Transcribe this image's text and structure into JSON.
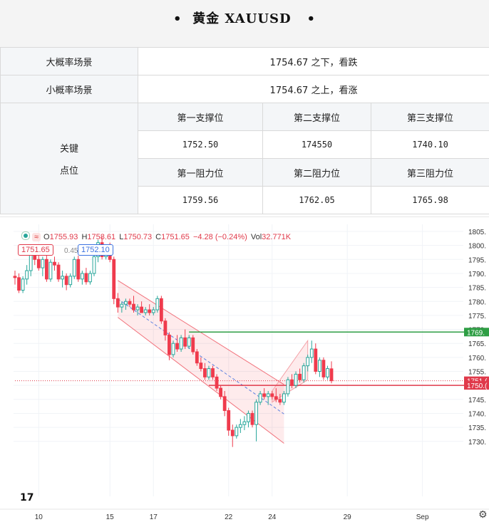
{
  "header": {
    "title": "•  黄金 XAUUSD   •"
  },
  "table": {
    "big_scenario_label": "大概率场景",
    "big_scenario_value": "1754.67 之下，看跌",
    "small_scenario_label": "小概率场景",
    "small_scenario_value": "1754.67 之上，看涨",
    "key_label_line1": "关键",
    "key_label_line2": "点位",
    "supports": [
      {
        "label": "第一支撑位",
        "value": "1752.50"
      },
      {
        "label": "第二支撑位",
        "value": "174550"
      },
      {
        "label": "第三支撑位",
        "value": "1740.10"
      }
    ],
    "resistances": [
      {
        "label": "第一阻力位",
        "value": "1759.56"
      },
      {
        "label": "第二阻力位",
        "value": "1762.05"
      },
      {
        "label": "第三阻力位",
        "value": "1765.98"
      }
    ]
  },
  "legend": {
    "wave": "≈",
    "o_label": "O",
    "o_value": "1755.93",
    "h_label": "H",
    "h_value": "1758.61",
    "l_label": "L",
    "l_value": "1750.73",
    "c_label": "C",
    "c_value": "1751.65",
    "change": "−4.28 (−0.24%)",
    "vol_label": "Vol",
    "vol_value": "32.771K"
  },
  "badges": {
    "sell": "1751.65",
    "spread": "0.45",
    "buy": "1752.10"
  },
  "chart_data": {
    "type": "candlestick",
    "y_ticks": [
      1805,
      1800,
      1795,
      1790,
      1785,
      1780,
      1775,
      1770,
      1765,
      1760,
      1755,
      1750,
      1745,
      1740,
      1735,
      1730
    ],
    "y_tick_labels": [
      "1805.",
      "1800.",
      "1795.",
      "1790.",
      "1785.",
      "1780.",
      "1775.",
      "1770.",
      "1765.",
      "1760.",
      "1755.",
      "1750.",
      "1745.",
      "1740.",
      "1735.",
      "1730."
    ],
    "x_tick_labels": [
      {
        "label": "10",
        "slot": 6
      },
      {
        "label": "15",
        "slot": 24
      },
      {
        "label": "17",
        "slot": 35
      },
      {
        "label": "22",
        "slot": 54
      },
      {
        "label": "24",
        "slot": 65
      },
      {
        "label": "29",
        "slot": 84
      },
      {
        "label": "Sep",
        "slot": 103
      }
    ],
    "price_labels": [
      {
        "text": "1769.",
        "value": 1769.05,
        "color": "#2e9e44"
      },
      {
        "text": "1751.(",
        "value": 1751.65,
        "color": "#e0394a"
      },
      {
        "text": "1750.(",
        "value": 1750.0,
        "color": "#e0394a"
      }
    ],
    "lines": [
      {
        "name": "resistance",
        "value": 1769.05,
        "from_slot": 44,
        "color": "#2e9e44"
      },
      {
        "name": "support",
        "value": 1750.0,
        "from_slot": 49,
        "color": "#e0394a"
      },
      {
        "name": "last-price",
        "value": 1751.65,
        "from_slot": 0,
        "color": "#e0394a"
      }
    ],
    "channel": {
      "upper_start": {
        "slot": 26,
        "value": 1787.5
      },
      "upper_end": {
        "slot": 68,
        "value": 1750.3
      },
      "lower_start": {
        "slot": 26,
        "value": 1774.3
      },
      "lower_end": {
        "slot": 68,
        "value": 1729.3
      },
      "mid_start": {
        "slot": 26,
        "value": 1780.9
      },
      "mid_end": {
        "slot": 68,
        "value": 1739.8
      }
    },
    "up_channel": {
      "upper_start": {
        "slot": 65,
        "value": 1748.0
      },
      "upper_end": {
        "slot": 74,
        "value": 1766.0
      },
      "lower_start": {
        "slot": 65,
        "value": 1744.0
      },
      "lower_end": {
        "slot": 74,
        "value": 1752.0
      }
    },
    "candles": [
      [
        1789.0,
        1791.0,
        1786.0,
        1788.5
      ],
      [
        1788.5,
        1790.0,
        1783.0,
        1784.0
      ],
      [
        1784.0,
        1789.0,
        1783.0,
        1788.0
      ],
      [
        1788.0,
        1793.0,
        1786.0,
        1791.0
      ],
      [
        1791.0,
        1798.0,
        1789.0,
        1797.0
      ],
      [
        1797.0,
        1799.0,
        1793.0,
        1795.0
      ],
      [
        1795.0,
        1797.0,
        1791.0,
        1792.0
      ],
      [
        1792.0,
        1796.0,
        1789.0,
        1795.0
      ],
      [
        1795.0,
        1797.0,
        1787.0,
        1788.0
      ],
      [
        1788.0,
        1795.0,
        1787.0,
        1794.0
      ],
      [
        1794.0,
        1796.0,
        1791.0,
        1793.0
      ],
      [
        1793.0,
        1794.0,
        1787.0,
        1788.0
      ],
      [
        1788.0,
        1791.0,
        1785.0,
        1789.0
      ],
      [
        1789.0,
        1790.0,
        1784.0,
        1786.0
      ],
      [
        1786.0,
        1790.0,
        1785.0,
        1789.0
      ],
      [
        1789.0,
        1796.0,
        1788.0,
        1795.0
      ],
      [
        1795.0,
        1797.0,
        1787.0,
        1788.0
      ],
      [
        1788.0,
        1791.0,
        1786.0,
        1790.0
      ],
      [
        1790.0,
        1792.0,
        1786.0,
        1787.0
      ],
      [
        1787.0,
        1791.0,
        1786.0,
        1790.0
      ],
      [
        1790.0,
        1797.0,
        1789.0,
        1796.0
      ],
      [
        1796.0,
        1802.0,
        1794.0,
        1801.0
      ],
      [
        1801.0,
        1803.0,
        1795.0,
        1796.0
      ],
      [
        1796.0,
        1799.0,
        1795.0,
        1798.0
      ],
      [
        1798.0,
        1801.0,
        1794.0,
        1795.0
      ],
      [
        1795.0,
        1796.0,
        1779.0,
        1781.0
      ],
      [
        1781.0,
        1783.0,
        1776.0,
        1778.0
      ],
      [
        1778.0,
        1780.0,
        1776.0,
        1779.0
      ],
      [
        1779.0,
        1781.0,
        1777.0,
        1780.0
      ],
      [
        1780.0,
        1781.0,
        1778.0,
        1779.0
      ],
      [
        1779.0,
        1782.0,
        1776.0,
        1777.0
      ],
      [
        1777.0,
        1779.0,
        1775.0,
        1778.0
      ],
      [
        1778.0,
        1780.0,
        1776.0,
        1776.0
      ],
      [
        1776.0,
        1778.0,
        1775.0,
        1777.0
      ],
      [
        1777.0,
        1779.0,
        1775.0,
        1776.0
      ],
      [
        1776.0,
        1778.0,
        1775.0,
        1777.0
      ],
      [
        1777.0,
        1782.0,
        1776.0,
        1781.0
      ],
      [
        1781.0,
        1782.0,
        1772.0,
        1773.0
      ],
      [
        1773.0,
        1774.0,
        1766.0,
        1768.0
      ],
      [
        1768.0,
        1769.0,
        1759.0,
        1761.0
      ],
      [
        1761.0,
        1766.0,
        1760.0,
        1765.0
      ],
      [
        1765.0,
        1768.0,
        1762.0,
        1763.0
      ],
      [
        1763.0,
        1768.0,
        1762.0,
        1767.0
      ],
      [
        1767.0,
        1770.0,
        1763.0,
        1764.0
      ],
      [
        1764.0,
        1768.0,
        1763.0,
        1767.0
      ],
      [
        1767.0,
        1768.0,
        1761.0,
        1762.0
      ],
      [
        1762.0,
        1763.0,
        1757.0,
        1758.0
      ],
      [
        1758.0,
        1760.0,
        1755.0,
        1756.0
      ],
      [
        1756.0,
        1758.0,
        1752.0,
        1753.0
      ],
      [
        1753.0,
        1757.0,
        1752.0,
        1756.0
      ],
      [
        1756.0,
        1757.0,
        1752.0,
        1753.0
      ],
      [
        1753.0,
        1754.0,
        1748.0,
        1749.0
      ],
      [
        1749.0,
        1750.0,
        1745.0,
        1746.0
      ],
      [
        1746.0,
        1748.0,
        1739.0,
        1741.0
      ],
      [
        1741.0,
        1742.0,
        1732.0,
        1734.0
      ],
      [
        1734.0,
        1736.0,
        1728.0,
        1732.0
      ],
      [
        1732.0,
        1736.0,
        1731.0,
        1735.0
      ],
      [
        1735.0,
        1738.0,
        1733.0,
        1736.0
      ],
      [
        1736.0,
        1739.0,
        1734.0,
        1737.0
      ],
      [
        1737.0,
        1741.0,
        1735.0,
        1740.0
      ],
      [
        1740.0,
        1741.0,
        1735.0,
        1736.0
      ],
      [
        1736.0,
        1745.0,
        1730.0,
        1744.0
      ],
      [
        1744.0,
        1748.0,
        1743.0,
        1747.0
      ],
      [
        1747.0,
        1749.0,
        1745.0,
        1746.0
      ],
      [
        1746.0,
        1748.0,
        1743.0,
        1747.0
      ],
      [
        1747.0,
        1748.0,
        1745.0,
        1746.0
      ],
      [
        1746.0,
        1749.0,
        1744.0,
        1745.0
      ],
      [
        1745.0,
        1747.0,
        1743.0,
        1744.0
      ],
      [
        1744.0,
        1748.0,
        1743.0,
        1747.0
      ],
      [
        1747.0,
        1753.0,
        1746.0,
        1752.0
      ],
      [
        1752.0,
        1754.0,
        1749.0,
        1750.0
      ],
      [
        1750.0,
        1755.0,
        1749.0,
        1754.0
      ],
      [
        1754.0,
        1756.0,
        1751.0,
        1752.0
      ],
      [
        1752.0,
        1758.0,
        1751.0,
        1757.0
      ],
      [
        1757.0,
        1761.0,
        1755.0,
        1760.0
      ],
      [
        1760.0,
        1766.0,
        1758.0,
        1763.0
      ],
      [
        1763.0,
        1765.0,
        1754.0,
        1755.0
      ],
      [
        1755.0,
        1760.0,
        1753.0,
        1759.0
      ],
      [
        1759.0,
        1760.0,
        1752.0,
        1753.0
      ],
      [
        1753.0,
        1757.0,
        1752.0,
        1756.0
      ],
      [
        1755.93,
        1758.61,
        1750.73,
        1751.65
      ]
    ]
  }
}
